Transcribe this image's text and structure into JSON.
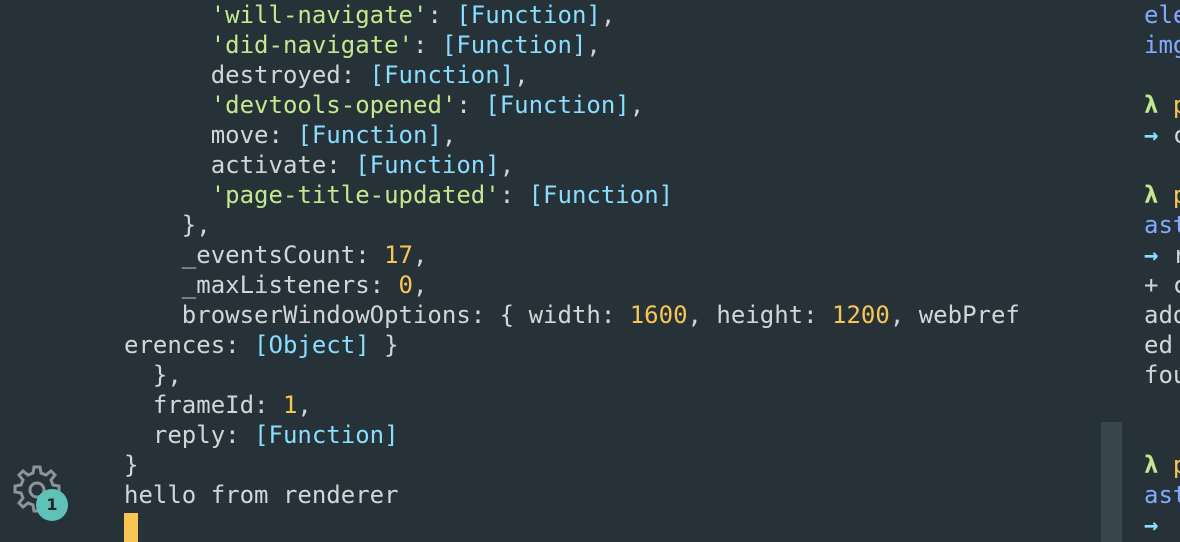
{
  "terminal_left": {
    "lines": [
      {
        "indent": "      ",
        "parts": [
          {
            "t": "'will-navigate'",
            "c": "str"
          },
          {
            "t": ": ",
            "c": "plain"
          },
          {
            "t": "[Function]",
            "c": "fn"
          },
          {
            "t": ",",
            "c": "plain"
          }
        ]
      },
      {
        "indent": "      ",
        "parts": [
          {
            "t": "'did-navigate'",
            "c": "str"
          },
          {
            "t": ": ",
            "c": "plain"
          },
          {
            "t": "[Function]",
            "c": "fn"
          },
          {
            "t": ",",
            "c": "plain"
          }
        ]
      },
      {
        "indent": "      ",
        "parts": [
          {
            "t": "destroyed: ",
            "c": "plain"
          },
          {
            "t": "[Function]",
            "c": "fn"
          },
          {
            "t": ",",
            "c": "plain"
          }
        ]
      },
      {
        "indent": "      ",
        "parts": [
          {
            "t": "'devtools-opened'",
            "c": "str"
          },
          {
            "t": ": ",
            "c": "plain"
          },
          {
            "t": "[Function]",
            "c": "fn"
          },
          {
            "t": ",",
            "c": "plain"
          }
        ]
      },
      {
        "indent": "      ",
        "parts": [
          {
            "t": "move: ",
            "c": "plain"
          },
          {
            "t": "[Function]",
            "c": "fn"
          },
          {
            "t": ",",
            "c": "plain"
          }
        ]
      },
      {
        "indent": "      ",
        "parts": [
          {
            "t": "activate: ",
            "c": "plain"
          },
          {
            "t": "[Function]",
            "c": "fn"
          },
          {
            "t": ",",
            "c": "plain"
          }
        ]
      },
      {
        "indent": "      ",
        "parts": [
          {
            "t": "'page-title-updated'",
            "c": "str"
          },
          {
            "t": ": ",
            "c": "plain"
          },
          {
            "t": "[Function]",
            "c": "fn"
          }
        ]
      },
      {
        "indent": "    ",
        "parts": [
          {
            "t": "},",
            "c": "plain"
          }
        ]
      },
      {
        "indent": "    ",
        "parts": [
          {
            "t": "_eventsCount: ",
            "c": "plain"
          },
          {
            "t": "17",
            "c": "num"
          },
          {
            "t": ",",
            "c": "plain"
          }
        ]
      },
      {
        "indent": "    ",
        "parts": [
          {
            "t": "_maxListeners: ",
            "c": "plain"
          },
          {
            "t": "0",
            "c": "num"
          },
          {
            "t": ",",
            "c": "plain"
          }
        ]
      },
      {
        "indent": "    ",
        "parts": [
          {
            "t": "browserWindowOptions: { width: ",
            "c": "plain"
          },
          {
            "t": "1600",
            "c": "num"
          },
          {
            "t": ", height: ",
            "c": "plain"
          },
          {
            "t": "1200",
            "c": "num"
          },
          {
            "t": ", webPref",
            "c": "plain"
          }
        ]
      },
      {
        "indent": "",
        "parts": [
          {
            "t": "erences: ",
            "c": "plain"
          },
          {
            "t": "[Object]",
            "c": "fn"
          },
          {
            "t": " }",
            "c": "plain"
          }
        ]
      },
      {
        "indent": "  ",
        "parts": [
          {
            "t": "},",
            "c": "plain"
          }
        ]
      },
      {
        "indent": "  ",
        "parts": [
          {
            "t": "frameId: ",
            "c": "plain"
          },
          {
            "t": "1",
            "c": "num"
          },
          {
            "t": ",",
            "c": "plain"
          }
        ]
      },
      {
        "indent": "  ",
        "parts": [
          {
            "t": "reply: ",
            "c": "plain"
          },
          {
            "t": "[Function]",
            "c": "fn"
          }
        ]
      },
      {
        "indent": "",
        "parts": [
          {
            "t": "}",
            "c": "plain"
          }
        ]
      },
      {
        "indent": "",
        "parts": [
          {
            "t": "hello from renderer",
            "c": "plain"
          }
        ]
      }
    ]
  },
  "terminal_right": {
    "lines": [
      {
        "parts": [
          {
            "t": "ele",
            "c": "blue"
          }
        ]
      },
      {
        "parts": [
          {
            "t": "img",
            "c": "blue"
          }
        ]
      },
      {
        "parts": [
          {
            "t": "",
            "c": "plain"
          }
        ]
      },
      {
        "parts": [
          {
            "t": "λ ",
            "c": "lambda"
          },
          {
            "t": "p",
            "c": "yellow"
          }
        ]
      },
      {
        "parts": [
          {
            "t": "→ ",
            "c": "arrow"
          },
          {
            "t": "c",
            "c": "plain"
          }
        ]
      },
      {
        "parts": [
          {
            "t": "",
            "c": "plain"
          }
        ]
      },
      {
        "parts": [
          {
            "t": "λ ",
            "c": "lambda"
          },
          {
            "t": "p",
            "c": "yellow"
          }
        ]
      },
      {
        "parts": [
          {
            "t": "ast",
            "c": "blue"
          }
        ]
      },
      {
        "parts": [
          {
            "t": "→ ",
            "c": "arrow"
          },
          {
            "t": "r",
            "c": "plain"
          }
        ]
      },
      {
        "parts": [
          {
            "t": "+ c",
            "c": "plain"
          }
        ]
      },
      {
        "parts": [
          {
            "t": "add",
            "c": "plain"
          }
        ]
      },
      {
        "parts": [
          {
            "t": "ed",
            "c": "plain"
          }
        ]
      },
      {
        "parts": [
          {
            "t": "fou",
            "c": "plain"
          }
        ]
      },
      {
        "parts": [
          {
            "t": "",
            "c": "plain"
          }
        ]
      },
      {
        "parts": [
          {
            "t": "",
            "c": "plain"
          }
        ]
      },
      {
        "parts": [
          {
            "t": "λ ",
            "c": "lambda"
          },
          {
            "t": "p",
            "c": "yellow"
          }
        ]
      },
      {
        "parts": [
          {
            "t": "ast",
            "c": "blue"
          }
        ]
      },
      {
        "parts": [
          {
            "t": "→ ",
            "c": "arrow"
          },
          {
            "t": "",
            "c": "plain"
          }
        ]
      }
    ]
  },
  "settings": {
    "icon": "gear-icon",
    "badge_count": "1"
  },
  "colors": {
    "background": "#263238",
    "string": "#c3e88d",
    "function": "#89ddff",
    "number": "#f8c555",
    "cursor": "#f8c555"
  }
}
